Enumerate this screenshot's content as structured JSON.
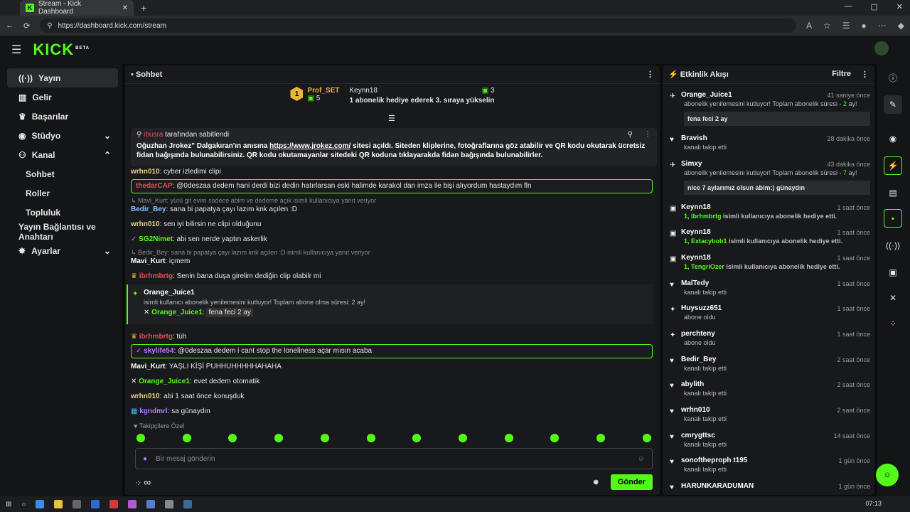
{
  "browser": {
    "tab_title": "Stream - Kick Dashboard",
    "url": "https://dashboard.kick.com/stream"
  },
  "brand": {
    "logo": "KICK",
    "beta": "BETA",
    "accent": "#53fc18"
  },
  "sidebar": {
    "items": [
      {
        "label": "Yayın",
        "icon": "broadcast-icon"
      },
      {
        "label": "Gelir",
        "icon": "revenue-icon"
      },
      {
        "label": "Başarılar",
        "icon": "trophy-icon"
      },
      {
        "label": "Stüdyo",
        "icon": "studio-icon"
      },
      {
        "label": "Kanal",
        "icon": "channel-icon"
      },
      {
        "label": "Sohbet"
      },
      {
        "label": "Roller"
      },
      {
        "label": "Topluluk"
      },
      {
        "label": "Yayın Bağlantısı ve Anahtarı"
      },
      {
        "label": "Ayarlar",
        "icon": "gear-icon"
      }
    ]
  },
  "chat": {
    "title": "Sohbet",
    "gifters": [
      {
        "rank": "1",
        "name": "Prof_SET",
        "count": "5"
      },
      {
        "name": "Keynn18",
        "count": "3",
        "note": "1 abonelik hediye ederek 3. sıraya yükselin"
      }
    ],
    "pinned": {
      "by": "ibusra",
      "by_suffix": "tarafından sabitlendi",
      "text_a": "Oğuzhan Jrokez\" Dalgakıran'ın anısına ",
      "link": "https://www.jrokez.com/",
      "text_b": " sitesi açıldı. Siteden kliplerine, fotoğraflarına göz atabilir ve QR kodu okutarak ücretsiz fidan bağışında bulunabilirsiniz. QR kodu okutamayanlar sitedeki QR koduna tıklayarakda fidan bağışında bulunabilirler."
    },
    "messages": [
      {
        "name": "wrhn010",
        "text": ": cyber izledimi clipi"
      },
      {
        "name": "thedarCAP",
        "text": ": @0deszaa dedem hani derdi bizi dedin hatırlarsan eski halimde karakol dan imza ile bişi alıyordum hastaydım fln"
      },
      {
        "reply": "Mavi_Kurt: yürü git evim sadece abim ve dedeme açık isimli kullanıcıya yanıt veriyor"
      },
      {
        "name": "Bedir_Bey",
        "text": ": sana bi papatya çayı lazım knk açılen :D"
      },
      {
        "name": "wrhn010",
        "text": ": sen iyi bilirsin ne clipi olduğunu"
      },
      {
        "name": "SG2Nimet",
        "text": ": abi sen nerde yaptın askerlik"
      },
      {
        "reply": "Bedir_Bey: sana bi papatya çayı lazım knk açılen :D isimli kullanıcıya yanıt veriyor"
      },
      {
        "name": "Mavi_Kurt",
        "text": ": içmem"
      },
      {
        "name": "ibrhmbrtg",
        "text": ": Senin bana duşa girelim dediğin clip olabilr mi"
      },
      {
        "name": "ibrhmbrtg",
        "text": ": tüh"
      },
      {
        "name": "skylife54",
        "text": ": @0deszaa dedem i cant stop the loneliness açar mısın acaba"
      },
      {
        "name": "Mavi_Kurt",
        "text": ": YAŞLI KİŞİ PUHHUHHHHHAHAHA"
      },
      {
        "name": "Orange_Juice1",
        "text": ": evet dedem otomatik"
      },
      {
        "name": "wrhn010",
        "text": ": abi 1 saat önce konuşduk"
      },
      {
        "name": "kgndmrl",
        "text": ": sa günaydın"
      }
    ],
    "sub_card": {
      "name": "Orange_Juice1",
      "desc": "isimli kullanıcı abonelik yenilemesini kutluyor! Toplam abone olma süresi: 2 ay!",
      "msg_name": "Orange_Juice1",
      "msg": "fena feci 2 ay"
    },
    "footnote": "Takipçilere Özel",
    "input_placeholder": "Bir mesaj gönderin",
    "send_label": "Gönder",
    "infinity": "∞"
  },
  "activity": {
    "title": "Etkinlik Akışı",
    "filter_label": "Filtre",
    "items": [
      {
        "name": "Orange_Juice1",
        "ago": "41 saniye önce",
        "icon": "resub-icon",
        "desc_a": "abonelik yenilemesini kutluyor! Toplam abonelik süresi - ",
        "desc_g": "2",
        "desc_b": " ay!",
        "box": "fena feci 2 ay"
      },
      {
        "name": "Bravish",
        "ago": "28 dakika önce",
        "icon": "heart-icon",
        "desc": "kanalı takip etti"
      },
      {
        "name": "Simxy",
        "ago": "43 dakika önce",
        "icon": "resub-icon",
        "desc_a": "abonelik yenilemesini kutluyor! Toplam abonelik süresi - ",
        "desc_g": "7",
        "desc_b": " ay!",
        "box": "nice 7 aylarımız olsun abim:) günaydın"
      },
      {
        "name": "Keynn18",
        "ago": "1 saat önce",
        "icon": "gift-icon",
        "gift_g": "1, ibrhmbrtg",
        "gift_rest": " isimli kullanıcıya abonelik hediye etti."
      },
      {
        "name": "Keynn18",
        "ago": "1 saat önce",
        "icon": "gift-icon",
        "gift_g": "1, Extacybob1",
        "gift_rest": " isimli kullanıcıya abonelik hediye etti."
      },
      {
        "name": "Keynn18",
        "ago": "1 saat önce",
        "icon": "gift-icon",
        "gift_g": "1, TengriOzer",
        "gift_rest": " isimli kullanıcıya abonelik hediye etti."
      },
      {
        "name": "MalTedy",
        "ago": "1 saat önce",
        "icon": "heart-icon",
        "desc": "kanalı takip etti"
      },
      {
        "name": "Huysuzz651",
        "ago": "1 saat önce",
        "icon": "sparkle-icon",
        "desc": "abone oldu"
      },
      {
        "name": "perchteny",
        "ago": "1 saat önce",
        "icon": "sparkle-icon",
        "desc": "abone oldu"
      },
      {
        "name": "Bedir_Bey",
        "ago": "2 saat önce",
        "icon": "heart-icon",
        "desc": "kanalı takip etti"
      },
      {
        "name": "abylith",
        "ago": "2 saat önce",
        "icon": "heart-icon",
        "desc": "kanalı takip etti"
      },
      {
        "name": "wrhn010",
        "ago": "2 saat önce",
        "icon": "heart-icon",
        "desc": "kanalı takip etti"
      },
      {
        "name": "cmrygttsc",
        "ago": "14 saat önce",
        "icon": "heart-icon",
        "desc": "kanalı takip etti"
      },
      {
        "name": "sonoftheproph t195",
        "ago": "1 gün önce",
        "icon": "heart-icon",
        "desc": "kanalı takip etti"
      },
      {
        "name": "HARUNKARADUMAN",
        "ago": "1 gün önce",
        "icon": "heart-icon"
      }
    ]
  },
  "taskbar": {
    "time": "07:13"
  }
}
